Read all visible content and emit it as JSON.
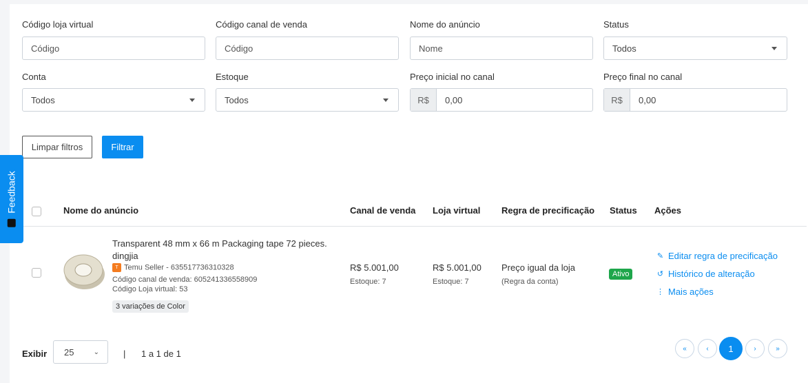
{
  "filters": {
    "codigo_loja": {
      "label": "Código loja virtual",
      "placeholder": "Código"
    },
    "codigo_canal": {
      "label": "Código canal de venda",
      "placeholder": "Código"
    },
    "nome_anuncio": {
      "label": "Nome do anúncio",
      "placeholder": "Nome"
    },
    "status": {
      "label": "Status",
      "value": "Todos"
    },
    "conta": {
      "label": "Conta",
      "value": "Todos"
    },
    "estoque": {
      "label": "Estoque",
      "value": "Todos"
    },
    "preco_inicial": {
      "label": "Preço inicial no canal",
      "prefix": "R$",
      "value": "0,00"
    },
    "preco_final": {
      "label": "Preço final no canal",
      "prefix": "R$",
      "value": "0,00"
    },
    "clear_label": "Limpar filtros",
    "filter_label": "Filtrar"
  },
  "feedback_label": "Feedback",
  "table": {
    "headers": {
      "nome": "Nome do anúncio",
      "canal": "Canal de venda",
      "loja": "Loja virtual",
      "regra": "Regra de precificação",
      "status": "Status",
      "acoes": "Ações"
    },
    "row": {
      "title_line1": "Transparent 48 mm x 66 m Packaging tape 72 pieces.",
      "title_line2": "dingjia",
      "seller": "Temu Seller - 635517736310328",
      "codigo_canal": "Código canal de venda: 605241336558909",
      "codigo_loja": "Código Loja virtual: 53",
      "variations": "3 variações de Color",
      "canal_price": "R$ 5.001,00",
      "canal_stock": "Estoque: 7",
      "loja_price": "R$ 5.001,00",
      "loja_stock": "Estoque: 7",
      "regra": "Preço igual da loja",
      "regra_sub": "(Regra da conta)",
      "status": "Ativo",
      "actions": {
        "edit": "Editar regra de precificação",
        "history": "Histórico de alteração",
        "more": "Mais ações"
      }
    }
  },
  "pagination": {
    "exibir_label": "Exibir",
    "page_size": "25",
    "range": "1 a 1 de 1",
    "current_page": "1",
    "first": "«",
    "prev": "‹",
    "next": "›",
    "last": "»"
  }
}
